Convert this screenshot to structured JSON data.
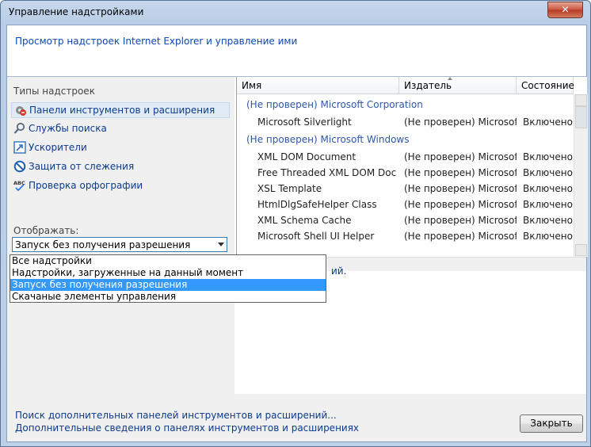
{
  "window": {
    "title": "Управление надстройками",
    "close_glyph": "✕"
  },
  "header": {
    "text": "Просмотр надстроек Internet Explorer и управление ими"
  },
  "sidebar": {
    "types_label": "Типы надстроек",
    "items": [
      {
        "label": "Панели инструментов и расширения",
        "icon": "gear-icon",
        "selected": true
      },
      {
        "label": "Службы поиска",
        "icon": "search-icon"
      },
      {
        "label": "Ускорители",
        "icon": "accelerator-icon"
      },
      {
        "label": "Защита от слежения",
        "icon": "block-icon"
      },
      {
        "label": "Проверка орфографии",
        "icon": "spellcheck-icon"
      }
    ],
    "display_label": "Отображать:",
    "combo_value": "Запуск без получения разрешения",
    "dropdown": [
      {
        "label": "Все надстройки"
      },
      {
        "label": "Надстройки, загруженные на данный момент"
      },
      {
        "label": "Запуск без получения разрешения",
        "selected": true
      },
      {
        "label": "Скачаные элементы управления"
      }
    ]
  },
  "list": {
    "columns": [
      "Имя",
      "Издатель",
      "Состояние"
    ],
    "groups": [
      {
        "label": "(Не проверен) Microsoft Corporation",
        "rows": [
          {
            "name": "Microsoft Silverlight",
            "publisher": "(Не проверен) Microsof...",
            "status": "Включено"
          }
        ]
      },
      {
        "label": "(Не проверен) Microsoft Windows",
        "rows": [
          {
            "name": "XML DOM Document",
            "publisher": "(Не проверен) Microsof...",
            "status": "Включено"
          },
          {
            "name": "Free Threaded XML DOM Docu...",
            "publisher": "(Не проверен) Microsof...",
            "status": "Включено"
          },
          {
            "name": "XSL Template",
            "publisher": "(Не проверен) Microsof...",
            "status": "Включено"
          },
          {
            "name": "HtmlDlgSafeHelper Class",
            "publisher": "(Не проверен) Microsof...",
            "status": "Включено"
          },
          {
            "name": "XML Schema Cache",
            "publisher": "(Не проверен) Microsof...",
            "status": "Включено"
          },
          {
            "name": "Microsoft Shell UI Helper",
            "publisher": "(Не проверен) Microsof...",
            "status": "Включено"
          }
        ]
      }
    ]
  },
  "partial_text": "ий.",
  "bottom": {
    "link1": "Поиск дополнительных панелей инструментов и расширений...",
    "link2": "Дополнительные сведения о панелях инструментов и расширениях",
    "close_button": "Закрыть"
  }
}
